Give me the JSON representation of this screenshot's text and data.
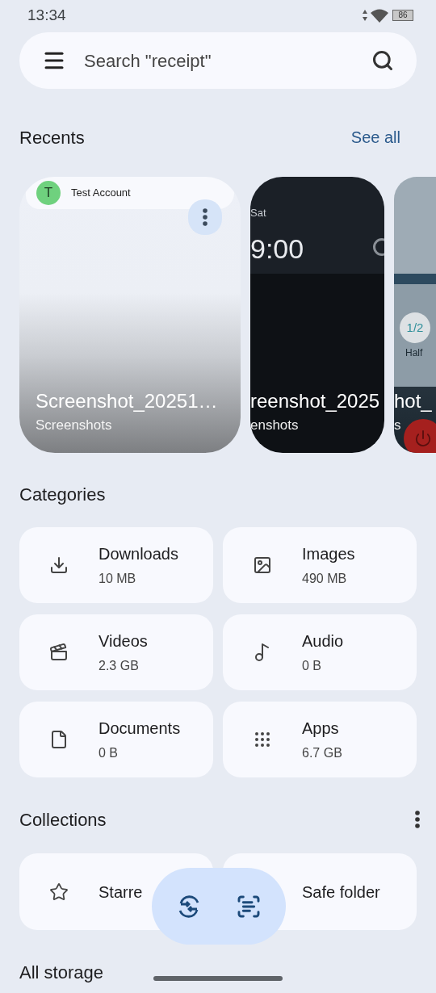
{
  "status_bar": {
    "time": "13:34",
    "battery": "86"
  },
  "search": {
    "placeholder": "Search \"receipt\""
  },
  "recents": {
    "title": "Recents",
    "link": "See all",
    "items": [
      {
        "kind": "light",
        "title": "Screenshot_20251…",
        "subtitle": "Screenshots",
        "preview": {
          "account_initial": "T",
          "account_name": "Test Account"
        }
      },
      {
        "kind": "dark",
        "title": "reenshot_2025",
        "subtitle": "enshots",
        "preview": {
          "day": "Sat",
          "clock": "9:00"
        }
      },
      {
        "kind": "cut",
        "title": "hot_",
        "subtitle": "s",
        "preview": {
          "count": "1/2",
          "label": "Half"
        }
      }
    ]
  },
  "categories": {
    "title": "Categories",
    "items": [
      {
        "label": "Downloads",
        "size": "10 MB"
      },
      {
        "label": "Images",
        "size": "490 MB"
      },
      {
        "label": "Videos",
        "size": "2.3 GB"
      },
      {
        "label": "Audio",
        "size": "0 B"
      },
      {
        "label": "Documents",
        "size": "0 B"
      },
      {
        "label": "Apps",
        "size": "6.7 GB"
      }
    ]
  },
  "collections": {
    "title": "Collections",
    "items": [
      {
        "label": "Starre"
      },
      {
        "label": "Safe folder"
      }
    ]
  },
  "all_storage": {
    "title": "All storage"
  }
}
